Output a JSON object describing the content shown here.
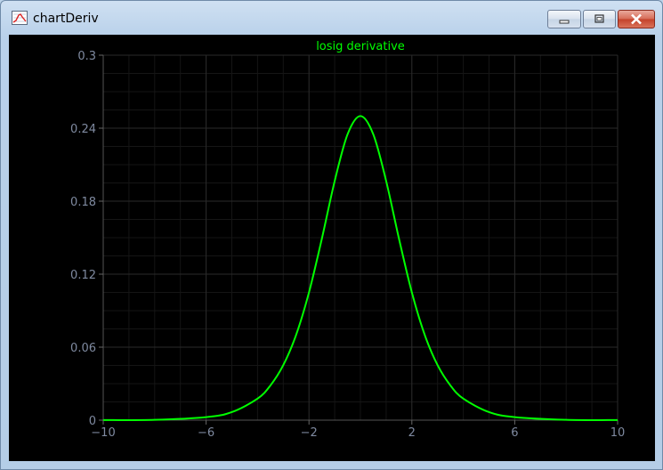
{
  "window": {
    "title": "chartDeriv",
    "icons": {
      "app": "chart-app-icon",
      "minimize": "minimize-icon",
      "maximize": "maximize-icon",
      "close": "close-icon"
    }
  },
  "colors": {
    "plot_background": "#000000",
    "grid": "#2a2a2a",
    "axis_text": "#7f8aa0",
    "series": "#00ff00",
    "title": "#00ff00"
  },
  "chart_data": {
    "type": "line",
    "title": "losig derivative",
    "xlabel": "",
    "ylabel": "",
    "xlim": [
      -10,
      10
    ],
    "ylim": [
      0,
      0.3
    ],
    "x_ticks": [
      "−10",
      "−6",
      "−2",
      "2",
      "6",
      "10"
    ],
    "x_tick_values": [
      -10,
      -6,
      -2,
      2,
      6,
      10
    ],
    "y_ticks": [
      "0",
      "0.06",
      "0.12",
      "0.18",
      "0.24",
      "0.3"
    ],
    "y_tick_values": [
      0,
      0.06,
      0.12,
      0.18,
      0.24,
      0.3
    ],
    "grid": true,
    "series": [
      {
        "x": [
          -10,
          -8,
          -6,
          -5,
          -4,
          -3.5,
          -3,
          -2.5,
          -2,
          -1.5,
          -1,
          -0.5,
          0,
          0.5,
          1,
          1.5,
          2,
          2.5,
          3,
          3.5,
          4,
          5,
          6,
          8,
          10
        ],
        "y": [
          5e-05,
          0.0003,
          0.0025,
          0.0066,
          0.0177,
          0.0285,
          0.0452,
          0.0701,
          0.105,
          0.1491,
          0.1966,
          0.235,
          0.25,
          0.235,
          0.1966,
          0.1491,
          0.105,
          0.0701,
          0.0452,
          0.0285,
          0.0177,
          0.0066,
          0.0025,
          0.0003,
          5e-05
        ]
      }
    ]
  }
}
